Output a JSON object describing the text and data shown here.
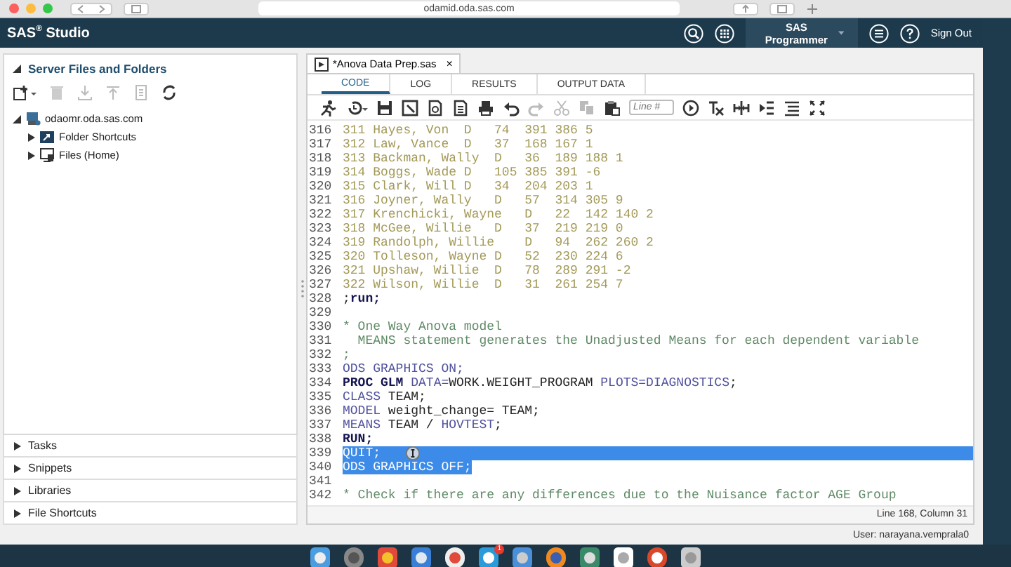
{
  "browser": {
    "address": "odamid.oda.sas.com"
  },
  "header": {
    "title": "SAS$^{®}$ Studio",
    "perspective": "SAS Programmer",
    "sign_out": "Sign Out"
  },
  "sidebar": {
    "title": "Server Files and Folders",
    "expanded": true,
    "tree": [
      {
        "label": "odaomr.oda.sas.com",
        "kind": "server",
        "expanded": true,
        "children": [
          {
            "label": "Folder Shortcuts",
            "kind": "shortcuts",
            "expanded": false
          },
          {
            "label": "Files (Home)",
            "kind": "home",
            "expanded": false
          }
        ]
      }
    ],
    "sections": [
      {
        "label": "Tasks",
        "expanded": false
      },
      {
        "label": "Snippets",
        "expanded": false
      },
      {
        "label": "Libraries",
        "expanded": false
      },
      {
        "label": "File Shortcuts",
        "expanded": false
      }
    ]
  },
  "editor": {
    "file_tab": {
      "label": "*Anova Data Prep.sas",
      "close": "×"
    },
    "tabs": [
      {
        "label": "CODE",
        "selected": true
      },
      {
        "label": "LOG",
        "selected": false
      },
      {
        "label": "RESULTS",
        "selected": false
      },
      {
        "label": "OUTPUT DATA",
        "selected": false
      }
    ],
    "line_field": {
      "placeholder": "Line #"
    },
    "lines": [
      {
        "number": "316",
        "selected": false,
        "tokens": [
          {
            "text": "311 Hayes, Von  D   74  391 386 5",
            "kind": "data"
          }
        ]
      },
      {
        "number": "317",
        "selected": false,
        "tokens": [
          {
            "text": "312 Law, Vance  D   37  168 167 1",
            "kind": "data"
          }
        ]
      },
      {
        "number": "318",
        "selected": false,
        "tokens": [
          {
            "text": "313 Backman, Wally  D   36  189 188 1",
            "kind": "data"
          }
        ]
      },
      {
        "number": "319",
        "selected": false,
        "tokens": [
          {
            "text": "314 Boggs, Wade D   105 385 391 -6",
            "kind": "data"
          }
        ]
      },
      {
        "number": "320",
        "selected": false,
        "tokens": [
          {
            "text": "315 Clark, Will D   34  204 203 1",
            "kind": "data"
          }
        ]
      },
      {
        "number": "321",
        "selected": false,
        "tokens": [
          {
            "text": "316 Joyner, Wally   D   57  314 305 9",
            "kind": "data"
          }
        ]
      },
      {
        "number": "322",
        "selected": false,
        "tokens": [
          {
            "text": "317 Krenchicki, Wayne   D   22  142 140 2",
            "kind": "data"
          }
        ]
      },
      {
        "number": "323",
        "selected": false,
        "tokens": [
          {
            "text": "318 McGee, Willie   D   37  219 219 0",
            "kind": "data"
          }
        ]
      },
      {
        "number": "324",
        "selected": false,
        "tokens": [
          {
            "text": "319 Randolph, Willie    D   94  262 260 2",
            "kind": "data"
          }
        ]
      },
      {
        "number": "325",
        "selected": false,
        "tokens": [
          {
            "text": "320 Tolleson, Wayne D   52  230 224 6",
            "kind": "data"
          }
        ]
      },
      {
        "number": "326",
        "selected": false,
        "tokens": [
          {
            "text": "321 Upshaw, Willie  D   78  289 291 -2",
            "kind": "data"
          }
        ]
      },
      {
        "number": "327",
        "selected": false,
        "tokens": [
          {
            "text": "322 Wilson, Willie  D   31  261 254 7",
            "kind": "data"
          }
        ]
      },
      {
        "number": "328",
        "selected": false,
        "tokens": [
          {
            "text": ";",
            "kind": "plain"
          },
          {
            "text": "run;",
            "kind": "bold"
          }
        ]
      },
      {
        "number": "329",
        "selected": false
      },
      {
        "number": "330",
        "selected": false,
        "tokens": [
          {
            "text": "* One Way Anova model",
            "kind": "comment"
          }
        ]
      },
      {
        "number": "331",
        "selected": false,
        "tokens": [
          {
            "text": "  MEANS statement generates the Unadjusted Means for each dependent variable",
            "kind": "comment"
          }
        ]
      },
      {
        "number": "332",
        "selected": false,
        "tokens": [
          {
            "text": ";",
            "kind": "comment"
          }
        ]
      },
      {
        "number": "333",
        "selected": false,
        "tokens": [
          {
            "text": "ODS GRAPHICS ON;",
            "kind": "keyword"
          }
        ]
      },
      {
        "number": "334",
        "selected": false,
        "tokens": [
          {
            "text": "PROC GLM",
            "kind": "bold"
          },
          {
            "text": " DATA=",
            "kind": "keyword"
          },
          {
            "text": "WORK.WEIGHT_PROGRAM ",
            "kind": "plain"
          },
          {
            "text": "PLOTS=DIAGNOSTICS",
            "kind": "keyword"
          },
          {
            "text": ";",
            "kind": "plain"
          }
        ]
      },
      {
        "number": "335",
        "selected": false,
        "tokens": [
          {
            "text": "CLASS",
            "kind": "keyword"
          },
          {
            "text": " TEAM;",
            "kind": "plain"
          }
        ]
      },
      {
        "number": "336",
        "selected": false,
        "tokens": [
          {
            "text": "MODEL",
            "kind": "keyword"
          },
          {
            "text": " weight_change= TEAM;",
            "kind": "plain"
          }
        ]
      },
      {
        "number": "337",
        "selected": false,
        "tokens": [
          {
            "text": "MEANS",
            "kind": "keyword"
          },
          {
            "text": " TEAM / ",
            "kind": "plain"
          },
          {
            "text": "HOVTEST",
            "kind": "keyword"
          },
          {
            "text": ";",
            "kind": "plain"
          }
        ]
      },
      {
        "number": "338",
        "selected": false,
        "tokens": [
          {
            "text": "RUN;",
            "kind": "bold"
          }
        ]
      },
      {
        "number": "339",
        "selected": true,
        "tokens": [
          {
            "text": "QUIT;",
            "kind": "keyword"
          }
        ]
      },
      {
        "number": "340",
        "selected": true,
        "tokens": [
          {
            "text": "ODS GRAPHICS OFF;",
            "kind": "keyword"
          }
        ]
      },
      {
        "number": "341",
        "selected": false
      },
      {
        "number": "342",
        "selected": false,
        "tokens": [
          {
            "text": "* Check if there are any differences due to the Nuisance factor AGE Group",
            "kind": "comment"
          }
        ]
      }
    ],
    "status": "Line 168, Column 31"
  },
  "footer": {
    "user": "User: narayana.vemprala0"
  },
  "dock": {
    "badge": "1"
  }
}
